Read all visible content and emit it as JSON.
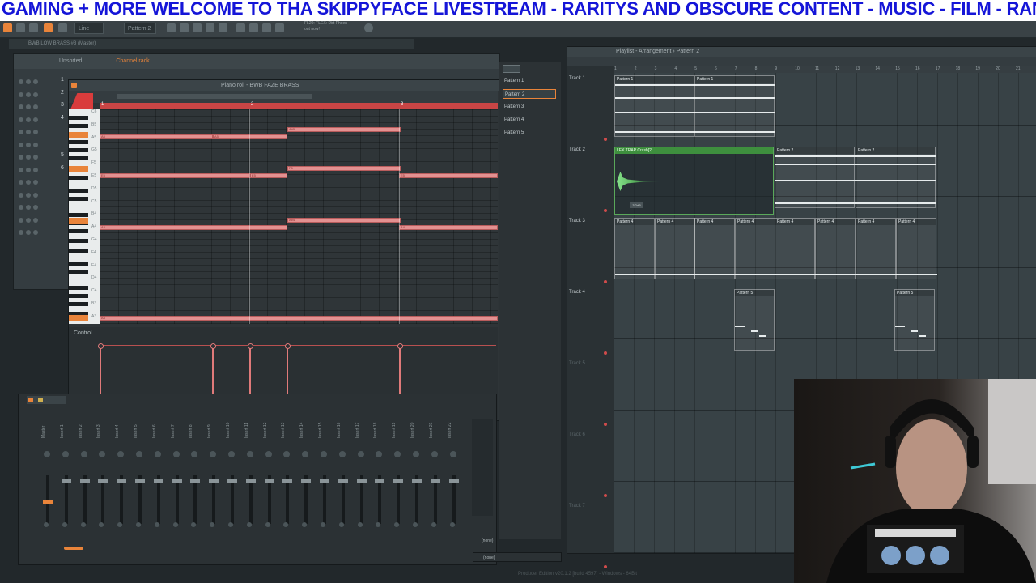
{
  "banner": {
    "text": "GAMING + MORE  WELCOME TO THA SKIPPYFACE LIVESTREAM  - RARITYS AND OBSCURE CONTENT - MUSIC - FILM - RANDO"
  },
  "toolbar": {
    "pattern_selector": "Pattern 2",
    "snap_mode": "Line",
    "news_line1": "FL20: FLEX: Dirt Phoen",
    "news_line2": "out now!"
  },
  "channel_rack": {
    "window_title": "Channel rack",
    "filter": "Unsorted",
    "header_title": "BWB LOW BRASS #3 (Master)",
    "row_numbers": [
      "1",
      "2",
      "3",
      "4",
      "",
      "",
      "5",
      "6",
      "",
      "",
      "",
      "",
      ""
    ]
  },
  "piano_roll": {
    "title": "Piano roll - BWB FAZE BRASS",
    "control_label": "Control",
    "ruler_marks": [
      "1",
      "2",
      "3"
    ],
    "key_labels": [
      "C6",
      "B5",
      "A5",
      "G5",
      "F5",
      "E5",
      "D5",
      "C5",
      "B4",
      "A4",
      "G4",
      "F4",
      "E4",
      "D4",
      "C4",
      "B3",
      "A3"
    ],
    "notes": [
      {
        "label": "A5",
        "lane": "A5"
      },
      {
        "label": "A5",
        "lane": "A5"
      },
      {
        "label": "A5",
        "lane": "A5"
      },
      {
        "label": "A#5",
        "lane": "A#5"
      },
      {
        "label": "E5",
        "lane": "E5"
      },
      {
        "label": "E5",
        "lane": "E5"
      },
      {
        "label": "E5",
        "lane": "E5"
      },
      {
        "label": "F5",
        "lane": "F5"
      },
      {
        "label": "A4",
        "lane": "A4"
      },
      {
        "label": "A#4",
        "lane": "A#4"
      },
      {
        "label": "A4",
        "lane": "A4"
      },
      {
        "label": "A3",
        "lane": "A3"
      }
    ]
  },
  "mixer": {
    "strips": [
      "Master",
      "Insert 1",
      "Insert 2",
      "Insert 3",
      "Insert 4",
      "Insert 5",
      "Insert 6",
      "Insert 7",
      "Insert 8",
      "Insert 9",
      "Insert 10",
      "Insert 11",
      "Insert 12",
      "Insert 13",
      "Insert 14",
      "Insert 15",
      "Insert 16",
      "Insert 17",
      "Insert 18",
      "Insert 19",
      "Insert 20",
      "Insert 21",
      "Insert 22"
    ],
    "routing_none_1": "(none)",
    "routing_none_2": "(none)"
  },
  "pattern_picker": {
    "items": [
      "Pattern 1",
      "Pattern 2",
      "Pattern 3",
      "Pattern 4",
      "Pattern 5"
    ],
    "selected_index": 1
  },
  "playlist": {
    "title": "Playlist - Arrangement › Pattern 2",
    "ruler": [
      "1",
      "2",
      "3",
      "4",
      "5",
      "6",
      "7",
      "8",
      "9",
      "10",
      "11",
      "12",
      "13",
      "14",
      "15",
      "16",
      "17",
      "18",
      "19",
      "20",
      "21"
    ],
    "tracks": [
      "Track 1",
      "Track 2",
      "Track 3",
      "Track 4",
      "Track 5",
      "Track 6",
      "Track 7"
    ],
    "clips": [
      {
        "track": 0,
        "label": "Pattern 1"
      },
      {
        "track": 0,
        "label": "Pattern 1"
      },
      {
        "track": 1,
        "label": "Pattern 2"
      },
      {
        "track": 1,
        "label": "Pattern 2"
      },
      {
        "track": 2,
        "label": "Pattern 4"
      },
      {
        "track": 2,
        "label": "Pattern 4"
      },
      {
        "track": 2,
        "label": "Pattern 4"
      },
      {
        "track": 2,
        "label": "Pattern 4"
      },
      {
        "track": 2,
        "label": "Pattern 4"
      },
      {
        "track": 2,
        "label": "Pattern 4"
      },
      {
        "track": 2,
        "label": "Pattern 4"
      },
      {
        "track": 2,
        "label": "Pattern 4"
      },
      {
        "track": 3,
        "label": "Pattern 5"
      },
      {
        "track": 3,
        "label": "Pattern 5"
      }
    ],
    "audio_clip": {
      "label": "LEX TRAP Crash[2]",
      "volume": "-3.2dB"
    }
  },
  "status_bar": {
    "text": "Producer Edition v20.1.2 [build 4597] - Windows - 64Bit"
  },
  "colors": {
    "banner_text": "#1515d8",
    "note": "#e39191",
    "accent": "#e9843a",
    "audio": "#3e8f3e"
  }
}
